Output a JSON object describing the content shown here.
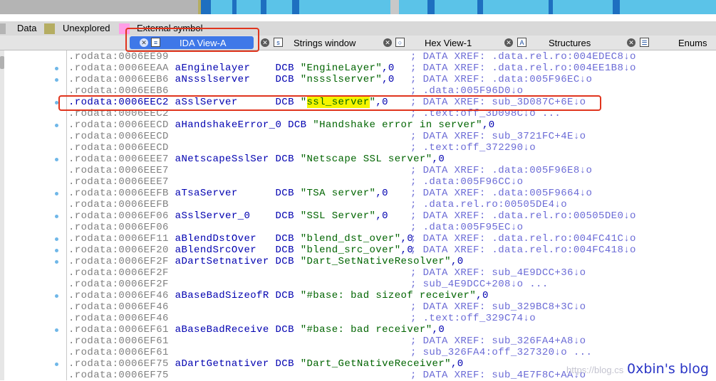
{
  "legend": {
    "items": [
      {
        "label": "Data",
        "color": "#b4b4b4"
      },
      {
        "label": "Unexplored",
        "color": "#b5ad62"
      },
      {
        "label": "External symbol",
        "color": "#ff9ee6"
      }
    ]
  },
  "tabs": [
    {
      "label": "IDA View-A",
      "icon": "ida-view-icon",
      "active": true
    },
    {
      "label": "Strings window",
      "icon": "strings-icon",
      "active": false
    },
    {
      "label": "Hex View-1",
      "icon": "hex-icon",
      "active": false
    },
    {
      "label": "Structures",
      "icon": "structures-icon",
      "active": false
    },
    {
      "label": "Enums",
      "icon": "enums-icon",
      "active": false
    }
  ],
  "listing": [
    {
      "addr": ".rodata:0006EE99",
      "name": "",
      "op": "",
      "str": "",
      "tail": "",
      "cmt": "; DATA XREF: .data.rel.ro:004EDEC8↓o",
      "bullet": false
    },
    {
      "addr": ".rodata:0006EEAA",
      "name": "aEnginelayer",
      "op": "DCB",
      "str": "\"EngineLayer\"",
      "tail": ",0",
      "cmt": "; DATA XREF: .data.rel.ro:004EE1B8↓o",
      "bullet": true
    },
    {
      "addr": ".rodata:0006EEB6",
      "name": "aNssslserver",
      "op": "DCB",
      "str": "\"nssslserver\"",
      "tail": ",0",
      "cmt": "; DATA XREF: .data:005F96EC↓o",
      "bullet": true
    },
    {
      "addr": ".rodata:0006EEB6",
      "name": "",
      "op": "",
      "str": "",
      "tail": "",
      "cmt": "; .data:005F96D0↓o",
      "bullet": false
    },
    {
      "addr": ".rodata:0006EEC2",
      "name": "aSslServer",
      "op": "DCB",
      "str": "ssl_server",
      "tail": ",0",
      "cmt": "; DATA XREF: sub_3D087C+6E↓o",
      "bullet": true,
      "highlight": true
    },
    {
      "addr": ".rodata:0006EEC2",
      "name": "",
      "op": "",
      "str": "",
      "tail": "",
      "cmt": "; .text:off_3D098C↓o ...",
      "bullet": false
    },
    {
      "addr": ".rodata:0006EECD",
      "name": "aHandshakeError_0",
      "op": "DCB",
      "str": "\"Handshake error in server\"",
      "tail": ",0",
      "cmt": "",
      "bullet": true
    },
    {
      "addr": ".rodata:0006EECD",
      "name": "",
      "op": "",
      "str": "",
      "tail": "",
      "cmt": "; DATA XREF: sub_3721FC+4E↓o",
      "bullet": false
    },
    {
      "addr": ".rodata:0006EECD",
      "name": "",
      "op": "",
      "str": "",
      "tail": "",
      "cmt": "; .text:off_372290↓o",
      "bullet": false
    },
    {
      "addr": ".rodata:0006EEE7",
      "name": "aNetscapeSslSer",
      "op": "DCB",
      "str": "\"Netscape SSL server\"",
      "tail": ",0",
      "cmt": "",
      "bullet": true
    },
    {
      "addr": ".rodata:0006EEE7",
      "name": "",
      "op": "",
      "str": "",
      "tail": "",
      "cmt": "; DATA XREF: .data:005F96E8↓o",
      "bullet": false
    },
    {
      "addr": ".rodata:0006EEE7",
      "name": "",
      "op": "",
      "str": "",
      "tail": "",
      "cmt": "; .data:005F96CC↓o",
      "bullet": false
    },
    {
      "addr": ".rodata:0006EEFB",
      "name": "aTsaServer",
      "op": "DCB",
      "str": "\"TSA server\"",
      "tail": ",0",
      "cmt": "; DATA XREF: .data:005F9664↓o",
      "bullet": true
    },
    {
      "addr": ".rodata:0006EEFB",
      "name": "",
      "op": "",
      "str": "",
      "tail": "",
      "cmt": "; .data.rel.ro:00505DE4↓o",
      "bullet": false
    },
    {
      "addr": ".rodata:0006EF06",
      "name": "aSslServer_0",
      "op": "DCB",
      "str": "\"SSL Server\"",
      "tail": ",0",
      "cmt": "; DATA XREF: .data.rel.ro:00505DE0↓o",
      "bullet": true
    },
    {
      "addr": ".rodata:0006EF06",
      "name": "",
      "op": "",
      "str": "",
      "tail": "",
      "cmt": "; .data:005F95EC↓o",
      "bullet": false
    },
    {
      "addr": ".rodata:0006EF11",
      "name": "aBlendDstOver",
      "op": "DCB",
      "str": "\"blend_dst_over\"",
      "tail": ",0",
      "cmt": "; DATA XREF: .data.rel.ro:004FC41C↓o",
      "bullet": true
    },
    {
      "addr": ".rodata:0006EF20",
      "name": "aBlendSrcOver",
      "op": "DCB",
      "str": "\"blend_src_over\"",
      "tail": ",0",
      "cmt": "; DATA XREF: .data.rel.ro:004FC418↓o",
      "bullet": true
    },
    {
      "addr": ".rodata:0006EF2F",
      "name": "aDartSetnativer",
      "op": "DCB",
      "str": "\"Dart_SetNativeResolver\"",
      "tail": ",0",
      "cmt": "",
      "bullet": true
    },
    {
      "addr": ".rodata:0006EF2F",
      "name": "",
      "op": "",
      "str": "",
      "tail": "",
      "cmt": "; DATA XREF: sub_4E9DCC+36↓o",
      "bullet": false
    },
    {
      "addr": ".rodata:0006EF2F",
      "name": "",
      "op": "",
      "str": "",
      "tail": "",
      "cmt": "; sub_4E9DCC+208↓o ...",
      "bullet": false
    },
    {
      "addr": ".rodata:0006EF46",
      "name": "aBaseBadSizeofR",
      "op": "DCB",
      "str": "\"#base: bad sizeof receiver\"",
      "tail": ",0",
      "cmt": "",
      "bullet": true
    },
    {
      "addr": ".rodata:0006EF46",
      "name": "",
      "op": "",
      "str": "",
      "tail": "",
      "cmt": "; DATA XREF: sub_329BC8+3C↓o",
      "bullet": false
    },
    {
      "addr": ".rodata:0006EF46",
      "name": "",
      "op": "",
      "str": "",
      "tail": "",
      "cmt": "; .text:off_329C74↓o",
      "bullet": false
    },
    {
      "addr": ".rodata:0006EF61",
      "name": "aBaseBadReceive",
      "op": "DCB",
      "str": "\"#base: bad receiver\"",
      "tail": ",0",
      "cmt": "",
      "bullet": true
    },
    {
      "addr": ".rodata:0006EF61",
      "name": "",
      "op": "",
      "str": "",
      "tail": "",
      "cmt": "; DATA XREF: sub_326FA4+A8↓o",
      "bullet": false
    },
    {
      "addr": ".rodata:0006EF61",
      "name": "",
      "op": "",
      "str": "",
      "tail": "",
      "cmt": "; sub_326FA4:off_327320↓o ...",
      "bullet": false
    },
    {
      "addr": ".rodata:0006EF75",
      "name": "aDartGetnativer",
      "op": "DCB",
      "str": "\"Dart_GetNativeReceiver\"",
      "tail": ",0",
      "cmt": "",
      "bullet": true
    },
    {
      "addr": ".rodata:0006EF75",
      "name": "",
      "op": "",
      "str": "",
      "tail": "",
      "cmt": "; DATA XREF: sub_4E7F8C+AA↓o",
      "bullet": false
    }
  ],
  "watermark": {
    "text": "0xbin's blog",
    "faint": "https://blog.cs"
  },
  "colors": {
    "accent": "#3f78e8",
    "annotation": "#e0341d",
    "highlight": "#f5f500"
  }
}
